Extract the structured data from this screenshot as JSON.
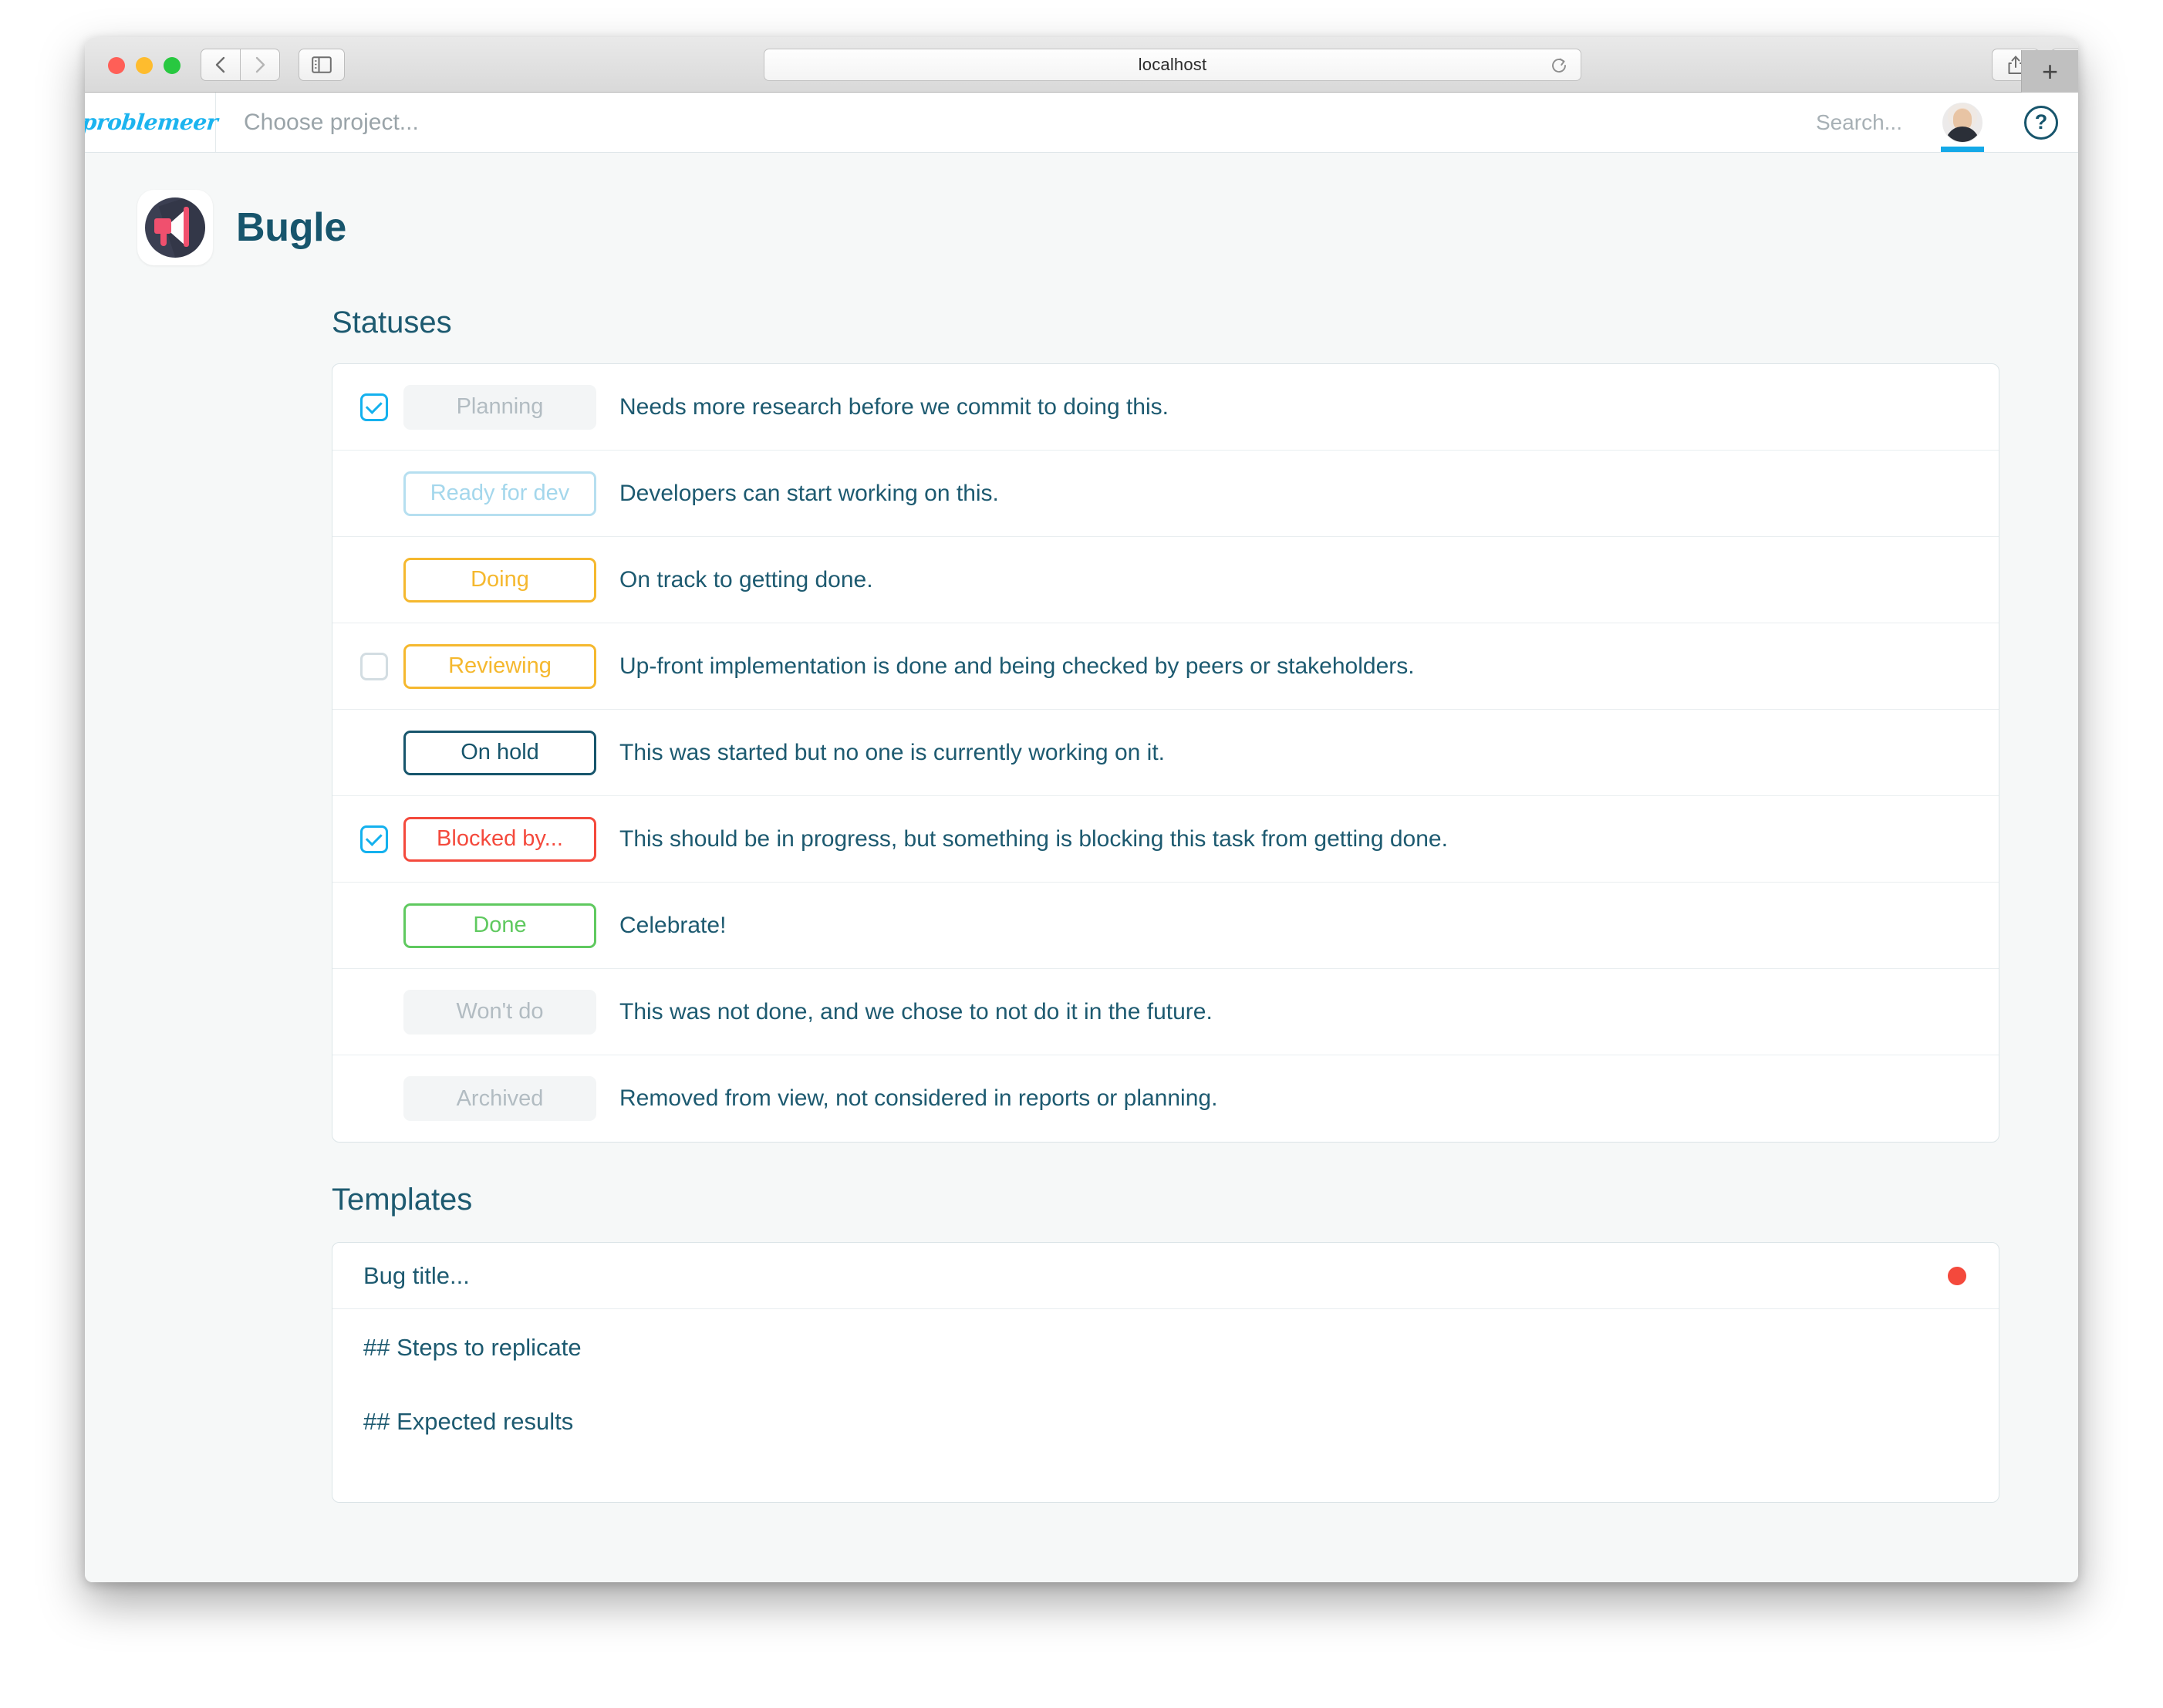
{
  "browser": {
    "url": "localhost",
    "back_icon": "chevron-left-icon",
    "forward_icon": "chevron-right-icon",
    "sidebar_icon": "sidebar-toggle-icon",
    "reload_icon": "reload-icon",
    "share_icon": "share-icon",
    "tabs_icon": "show-tabs-icon",
    "new_tab_label": "+"
  },
  "app_header": {
    "brand": "problemeer",
    "project_picker_placeholder": "Choose project...",
    "search_placeholder": "Search...",
    "avatar_name": "user-avatar",
    "help_label": "?"
  },
  "project": {
    "name": "Bugle",
    "icon": "megaphone-icon"
  },
  "sections": {
    "statuses_heading": "Statuses",
    "templates_heading": "Templates"
  },
  "statuses": [
    {
      "label": "Planning",
      "description": "Needs more research before we commit to doing this.",
      "style": "muted",
      "checkbox": "checked"
    },
    {
      "label": "Ready for dev",
      "description": "Developers can start working on this.",
      "style": "lightblue",
      "checkbox": "none"
    },
    {
      "label": "Doing",
      "description": "On track to getting done.",
      "style": "amber",
      "checkbox": "none"
    },
    {
      "label": "Reviewing",
      "description": "Up-front implementation is done and being checked by peers or stakeholders.",
      "style": "amber",
      "checkbox": "unchecked"
    },
    {
      "label": "On hold",
      "description": "This was started but no one is currently working on it.",
      "style": "navy",
      "checkbox": "none"
    },
    {
      "label": "Blocked by...",
      "description": "This should be in progress, but something is blocking this task from getting done.",
      "style": "red",
      "checkbox": "checked"
    },
    {
      "label": "Done",
      "description": "Celebrate!",
      "style": "green",
      "checkbox": "none"
    },
    {
      "label": "Won't do",
      "description": "This was not done, and we chose to not do it in the future.",
      "style": "muted",
      "checkbox": "none"
    },
    {
      "label": "Archived",
      "description": "Removed from view, not considered in reports or planning.",
      "style": "muted",
      "checkbox": "none"
    }
  ],
  "template": {
    "title_placeholder": "Bug title...",
    "dot_color": "#f4493c",
    "lines": [
      "## Steps to replicate",
      "## Expected results"
    ]
  },
  "colors": {
    "accent": "#14b1ee",
    "text_primary": "#1d5a70",
    "amber": "#f5b82e",
    "red": "#f4493c",
    "green": "#5fc95f",
    "light_blue": "#a4d7ec",
    "muted": "#b2bcc2",
    "page_bg": "#f6f8f8"
  }
}
